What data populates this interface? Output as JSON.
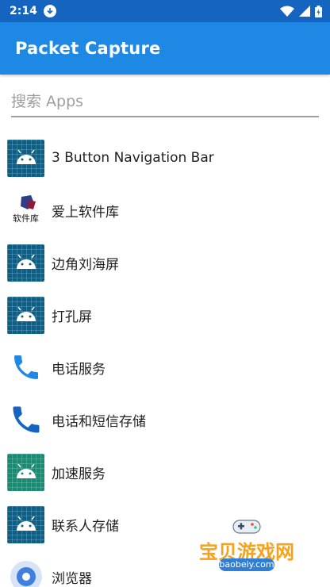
{
  "status_bar": {
    "time": "2:14",
    "icons": [
      "download-icon",
      "wifi-icon",
      "signal-icon",
      "battery-icon"
    ]
  },
  "app_bar": {
    "title": "Packet Capture"
  },
  "search": {
    "placeholder": "搜索 Apps",
    "value": ""
  },
  "apps": [
    {
      "label": "3 Button Navigation Bar",
      "icon": "android-icon"
    },
    {
      "label": "爱上软件库",
      "icon": "software-library-logo"
    },
    {
      "label": "边角刘海屏",
      "icon": "android-icon"
    },
    {
      "label": "打孔屏",
      "icon": "android-icon"
    },
    {
      "label": "电话服务",
      "icon": "phone-icon"
    },
    {
      "label": "电话和短信存储",
      "icon": "phone-icon"
    },
    {
      "label": "加速服务",
      "icon": "android-icon"
    },
    {
      "label": "联系人存储",
      "icon": "android-icon"
    },
    {
      "label": "浏览器",
      "icon": "browser-icon"
    }
  ],
  "colors": {
    "status_bar": "#1565c0",
    "app_bar": "#1e88e5",
    "android_tile": "#0d5f86",
    "android_tile_green": "#1b8a73"
  },
  "watermark": {
    "text": "宝贝游戏网",
    "url": "baobeiy.com"
  },
  "logo_text": "软件库"
}
